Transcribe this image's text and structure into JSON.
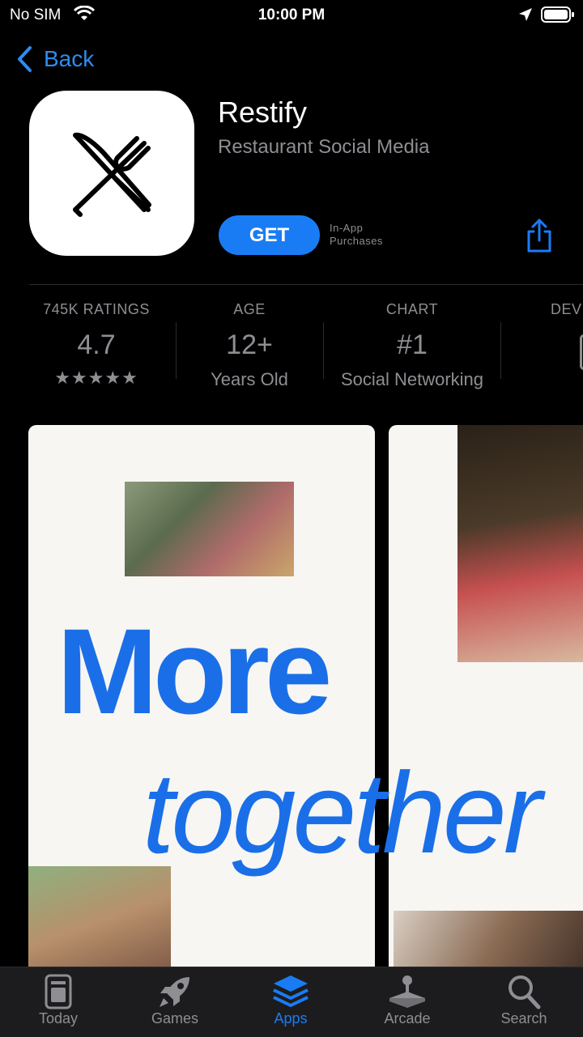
{
  "status_bar": {
    "carrier": "No SIM",
    "time": "10:00 PM"
  },
  "nav": {
    "back_label": "Back"
  },
  "app": {
    "name": "Restify",
    "subtitle": "Restaurant Social Media",
    "get_label": "GET",
    "in_app_line1": "In-App",
    "in_app_line2": "Purchases"
  },
  "info": {
    "ratings_label": "745K RATINGS",
    "rating_value": "4.7",
    "stars": "★★★★★",
    "age_label": "AGE",
    "age_value": "12+",
    "age_sub": "Years Old",
    "chart_label": "CHART",
    "chart_value": "#1",
    "chart_sub": "Social Networking",
    "dev_label": "DEV"
  },
  "screenshots": {
    "word1": "More",
    "word2": "together"
  },
  "tabs": [
    {
      "label": "Today",
      "icon": "today-icon"
    },
    {
      "label": "Games",
      "icon": "rocket-icon"
    },
    {
      "label": "Apps",
      "icon": "layers-icon"
    },
    {
      "label": "Arcade",
      "icon": "joystick-icon"
    },
    {
      "label": "Search",
      "icon": "search-icon"
    }
  ],
  "colors": {
    "accent": "#1a7cf5",
    "background": "#000000",
    "secondary_text": "#8e8e93"
  }
}
